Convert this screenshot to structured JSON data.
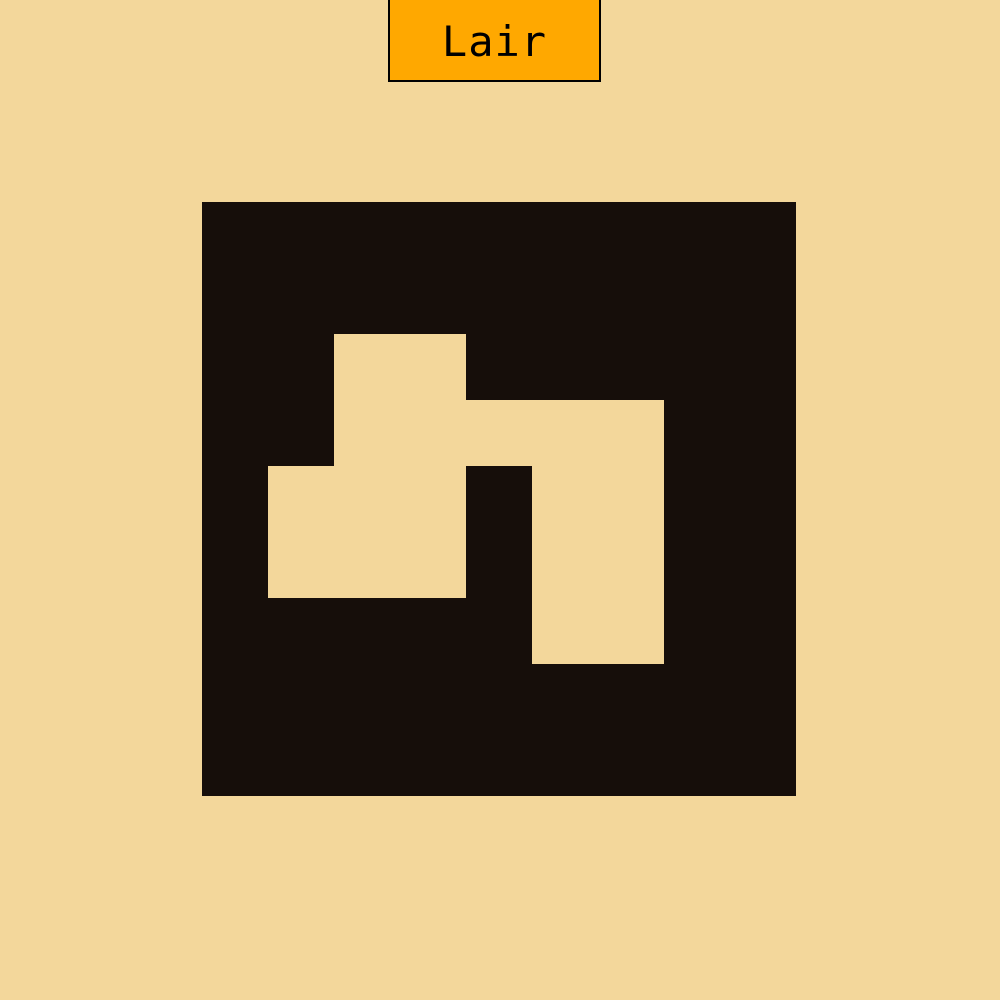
{
  "title": "Lair",
  "colors": {
    "background": "#f3d79b",
    "wall": "#160e0a",
    "floor": "#f3d79b",
    "title_tab": "#ffa800",
    "title_border": "#000000"
  },
  "map": {
    "rows": [
      "#########",
      "#########",
      "##..#####",
      "##.....##",
      "#...#..##",
      "#...#..##",
      "#####..##",
      "#########",
      "#########"
    ],
    "legend": {
      "#": "wall",
      ".": "floor"
    }
  }
}
